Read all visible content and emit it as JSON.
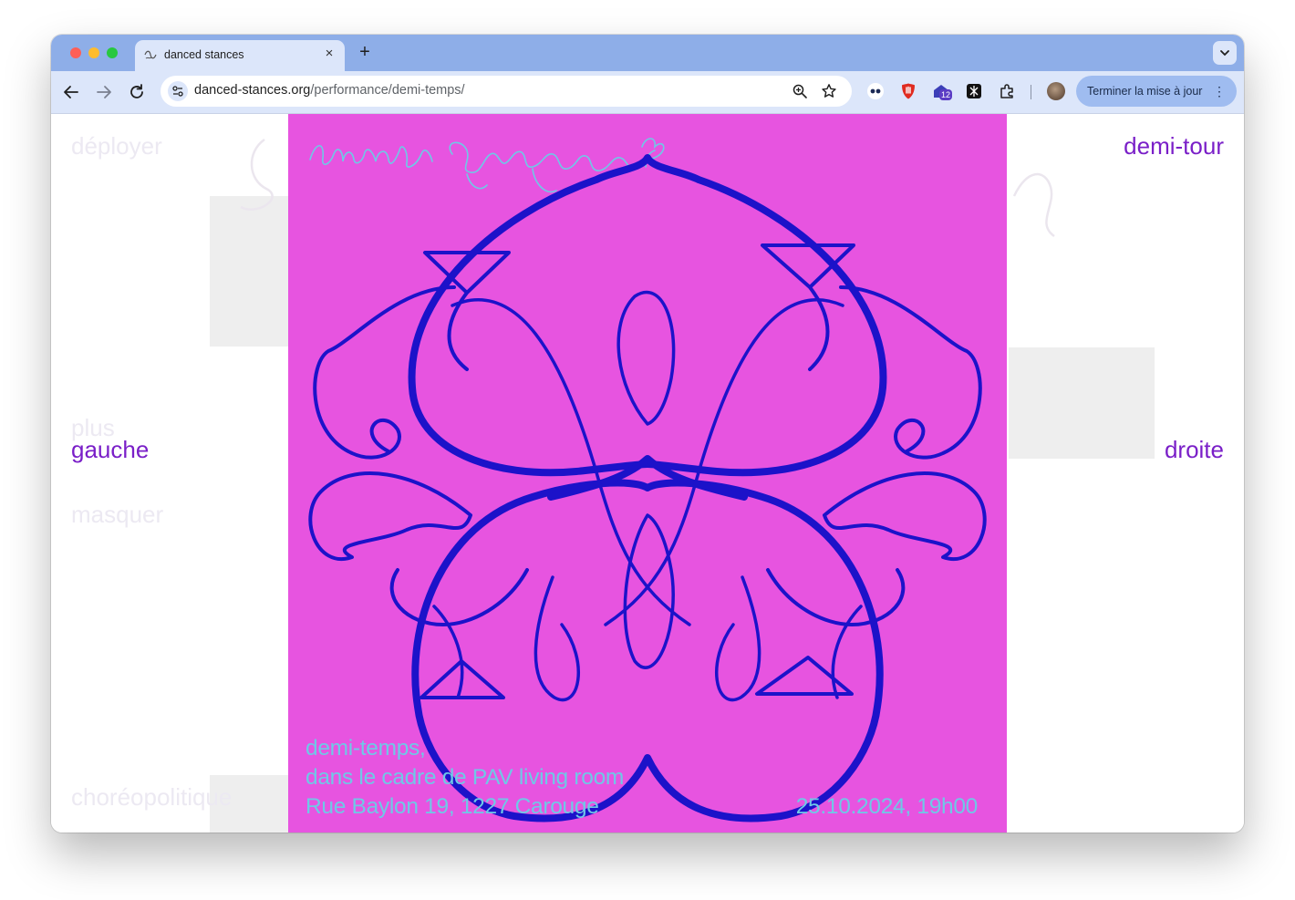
{
  "browser": {
    "tab_title": "danced stances",
    "tab_close": "×",
    "new_tab": "+",
    "url_host": "danced-stances.org",
    "url_path": "/performance/demi-temps/",
    "update_button": "Terminer la mise à jour",
    "menu_glyph": "⋮",
    "extension_badge": "12"
  },
  "page": {
    "menu_left": {
      "deploy": "déployer",
      "more": "plus",
      "left": "gauche",
      "hide": "masquer",
      "choreopolitics": "choréopolitique"
    },
    "menu_right": {
      "turn": "demi-tour",
      "right": "droite"
    },
    "poster": {
      "event_title": "demi-temps,",
      "event_context": "dans le cadre de PAV living room",
      "event_address": "Rue Baylon 19, 1227 Carouge",
      "event_datetime": "25.10.2024, 19h00",
      "background_color": "#e754e0",
      "ornament_color": "#1c12c9",
      "text_color": "#6fc9e6"
    },
    "accent_color": "#7a1fc8"
  }
}
